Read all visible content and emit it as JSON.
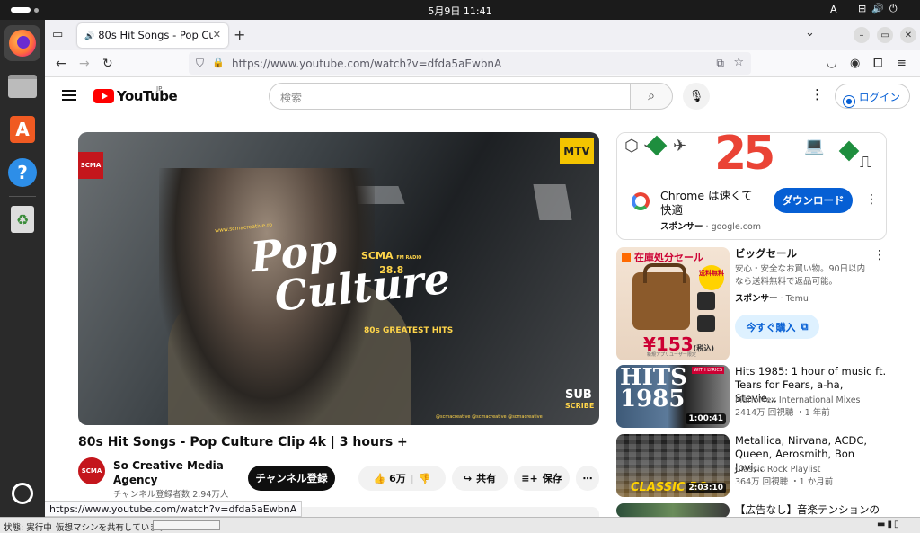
{
  "topbar": {
    "clock": "5月9日  11:41",
    "ime": "A",
    "sys_icons": "⊞🔊⏻"
  },
  "dock": {
    "apps": [
      "firefox-icon",
      "files-icon",
      "app-center-icon",
      "help-icon",
      "trash-icon"
    ]
  },
  "browser": {
    "tab_title": "80s Hit Songs - Pop Cultu",
    "url": "https://www.youtube.com/watch?v=dfda5aEwbnA",
    "hover_url": "https://www.youtube.com/watch?v=dfda5aEwbnA"
  },
  "youtube": {
    "logo": "YouTube",
    "region": "JP",
    "search_placeholder": "検索",
    "login": "ログイン"
  },
  "video": {
    "overlay": {
      "badge": "SCMA",
      "website": "www.scmacreative.ro",
      "radio_name": "SCMA",
      "radio_tag": "FM RADIO",
      "radio_freq": "28.8",
      "title_line1": "Pop",
      "title_line2": "Culture",
      "subtitle": "80s GREATEST HITS",
      "subscribe_1": "SUB",
      "subscribe_2": "SCRIBE",
      "socials": "@scmacreative   @scmacreative   @scmacreative",
      "mtv": "MTV"
    },
    "title": "80s Hit Songs - Pop Culture Clip 4k | 3 hours +",
    "channel": "So Creative Media Agency",
    "subscribers": "チャンネル登録者数 2.94万人",
    "subscribe_btn": "チャンネル登録",
    "likes": "6万",
    "share": "共有",
    "save": "保存"
  },
  "sidebar": {
    "ad1": {
      "banner": "25",
      "text": "Chrome は速くて快適",
      "sponsor_label": "スポンサー",
      "sponsor_domain": "google.com",
      "button": "ダウンロード"
    },
    "ad2": {
      "image_header": "在庫処分セール",
      "image_tag": "送料無料",
      "image_price": "¥153",
      "image_price_unit": "(税込)",
      "image_note": "新規アプリユーザー限定",
      "title": "ビッグセール",
      "desc": "安心・安全なお買い物。90日以内なら送料無料で返品可能。",
      "sponsor_label": "スポンサー",
      "sponsor_name": "Temu",
      "button": "今すぐ購入"
    },
    "videos": [
      {
        "title": "Hits 1985: 1 hour of music ft. Tears for Fears, a-ha, Stevie...",
        "channel": "MarioMex International Mixes",
        "meta": "2414万 回視聴 ・1 年前",
        "duration": "1:00:41",
        "thumb_text": "HITS 1985",
        "thumb_badge": "WITH LYRICS"
      },
      {
        "title": "Metallica, Nirvana, ACDC, Queen, Aerosmith, Bon Jovi,...",
        "channel": "Classic Rock Playlist",
        "meta": "364万 回視聴 ・1 か月前",
        "duration": "2:03:10",
        "thumb_text": "CLASSIC RO"
      },
      {
        "title": "【広告なし】音楽テンションの"
      }
    ]
  },
  "statusbar": {
    "state": "状態: 実行中",
    "message": "仮想マシンを共有しています..."
  }
}
